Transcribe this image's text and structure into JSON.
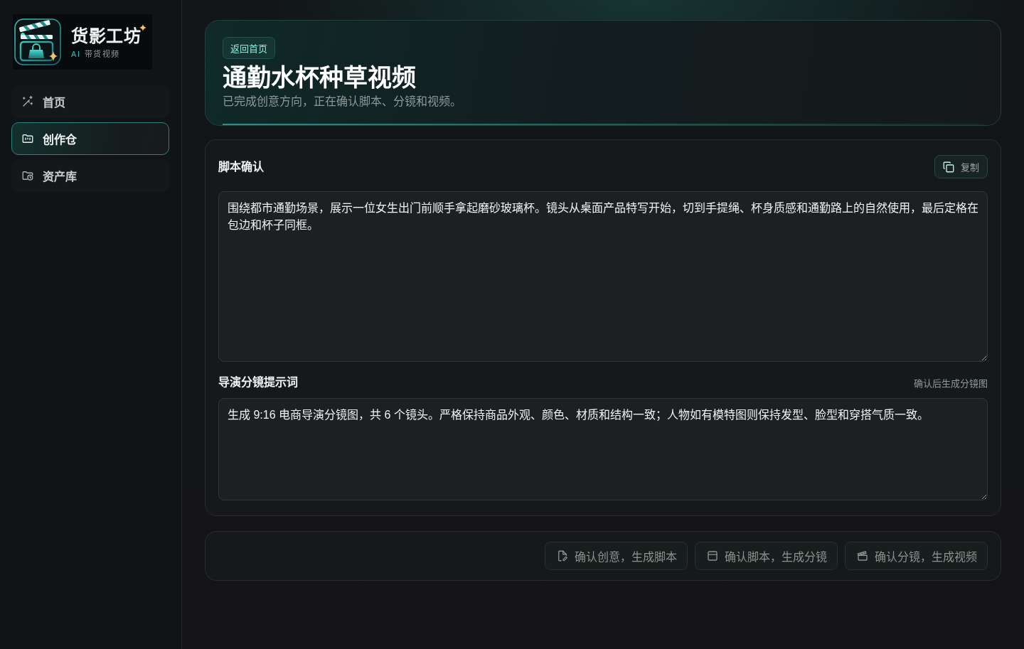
{
  "sidebar": {
    "logo": {
      "name": "货影工坊",
      "tag": "AI",
      "subtitle": "带货视频"
    },
    "items": [
      {
        "label": "首页",
        "selected": false
      },
      {
        "label": "创作仓",
        "selected": true
      },
      {
        "label": "资产库",
        "selected": false
      }
    ]
  },
  "header": {
    "back_button": "返回首页",
    "title": "通勤水杯种草视频",
    "subtitle": "已完成创意方向，正在确认脚本、分镜和视频。"
  },
  "script": {
    "title": "脚本确认",
    "copy_button": "复制",
    "value": "围绕都市通勤场景，展示一位女生出门前顺手拿起磨砂玻璃杯。镜头从桌面产品特写开始，切到手提绳、杯身质感和通勤路上的自然使用，最后定格在包边和杯子同框。"
  },
  "prompt": {
    "title": "导演分镜提示词",
    "hint": "确认后生成分镜图",
    "value": "生成 9:16 电商导演分镜图，共 6 个镜头。严格保持商品外观、颜色、材质和结构一致；人物如有模特图则保持发型、脸型和穿搭气质一致。"
  },
  "actions": [
    {
      "label": "确认创意，生成脚本",
      "disabled": true
    },
    {
      "label": "确认脚本，生成分镜",
      "disabled": true
    },
    {
      "label": "确认分镜，生成视频",
      "disabled": true
    }
  ]
}
